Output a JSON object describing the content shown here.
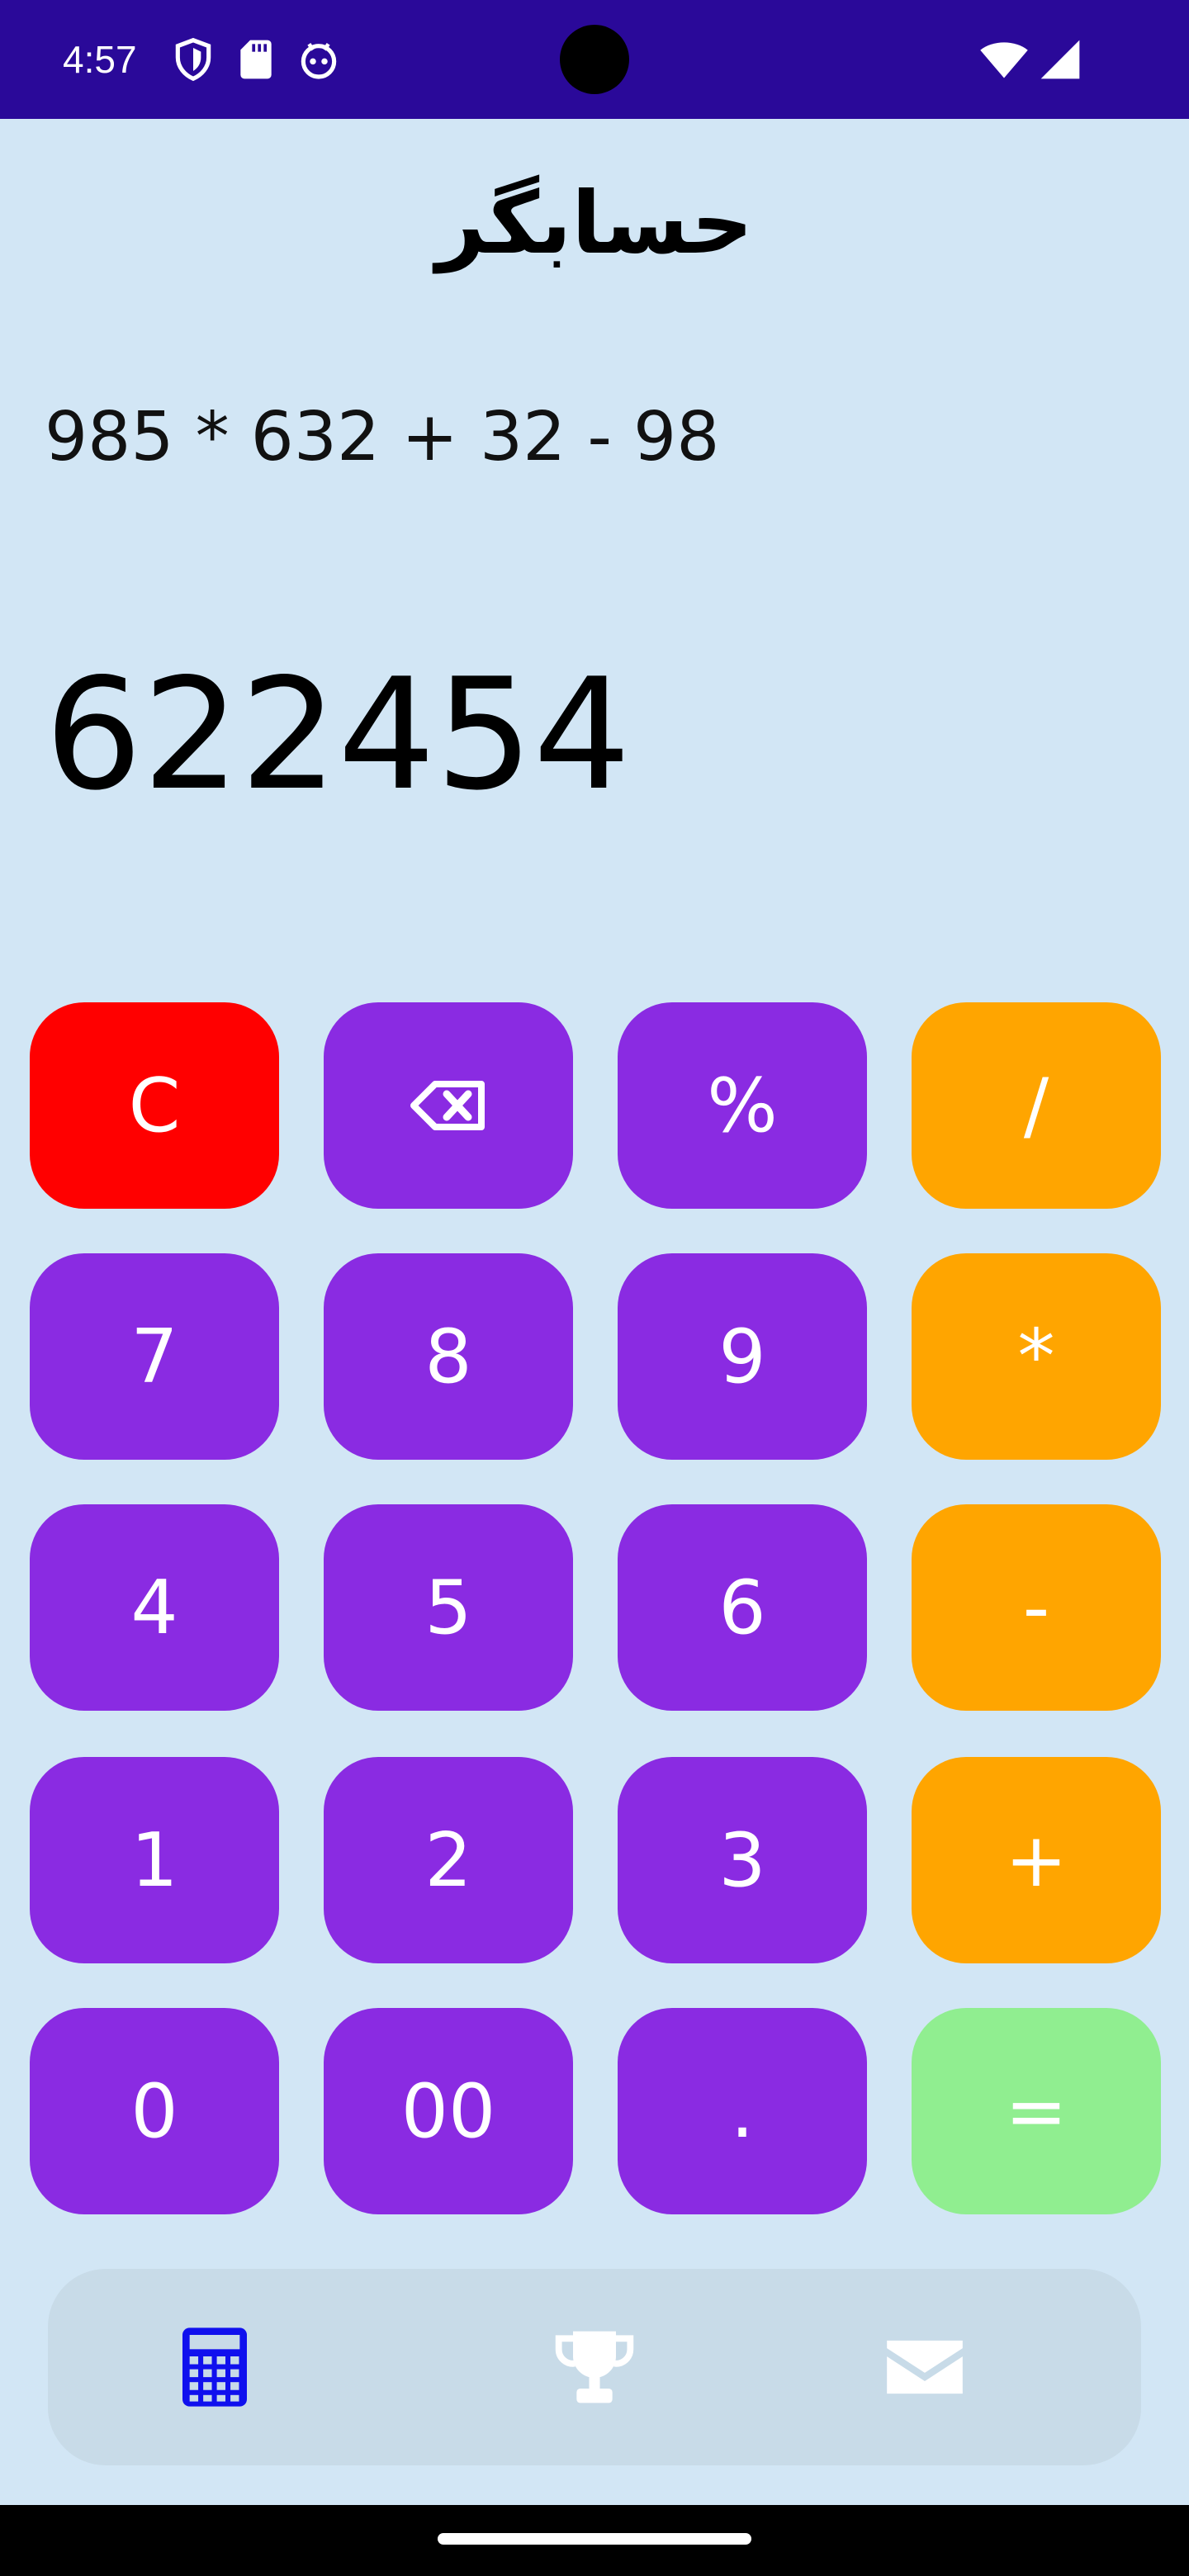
{
  "status_bar": {
    "time": "4:57",
    "left_icons": [
      "shield-icon",
      "sd-card-icon",
      "android-robot-icon"
    ],
    "right_icons": [
      "wifi-icon",
      "cellular-signal-icon"
    ],
    "background_color": "#2a0999"
  },
  "header": {
    "title": "حسابگر"
  },
  "display": {
    "expression": "985 * 632 + 32 - 98",
    "result": "622454"
  },
  "keypad": {
    "colors": {
      "clear": "#ff0000",
      "digit": "#8a2be2",
      "operator": "#ffa500",
      "equals": "#90ee90"
    },
    "rows": [
      [
        {
          "label": "C",
          "role": "clear"
        },
        {
          "label": "",
          "role": "backspace",
          "icon": "backspace-icon"
        },
        {
          "label": "%",
          "role": "percent"
        },
        {
          "label": "/",
          "role": "divide"
        }
      ],
      [
        {
          "label": "7",
          "role": "digit"
        },
        {
          "label": "8",
          "role": "digit"
        },
        {
          "label": "9",
          "role": "digit"
        },
        {
          "label": "*",
          "role": "multiply"
        }
      ],
      [
        {
          "label": "4",
          "role": "digit"
        },
        {
          "label": "5",
          "role": "digit"
        },
        {
          "label": "6",
          "role": "digit"
        },
        {
          "label": "-",
          "role": "subtract"
        }
      ],
      [
        {
          "label": "1",
          "role": "digit"
        },
        {
          "label": "2",
          "role": "digit"
        },
        {
          "label": "3",
          "role": "digit"
        },
        {
          "label": "+",
          "role": "add"
        }
      ],
      [
        {
          "label": "0",
          "role": "digit"
        },
        {
          "label": "00",
          "role": "digit"
        },
        {
          "label": ".",
          "role": "decimal"
        },
        {
          "label": "=",
          "role": "equals"
        }
      ]
    ]
  },
  "bottom_nav": {
    "items": [
      {
        "icon": "calculator-icon",
        "active": true
      },
      {
        "icon": "trophy-icon",
        "active": false
      },
      {
        "icon": "envelope-icon",
        "active": false
      }
    ],
    "active_color": "#1010ee",
    "inactive_color": "#ffffff"
  }
}
